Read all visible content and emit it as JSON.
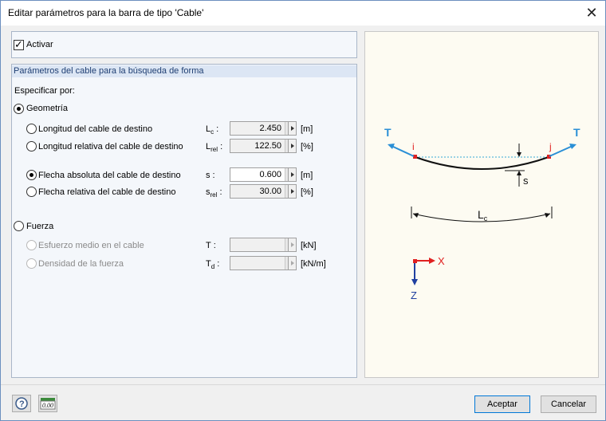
{
  "window": {
    "title": "Editar parámetros para la barra de tipo 'Cable'",
    "close_glyph": "✕"
  },
  "activar": {
    "label": "Activar",
    "checked": true
  },
  "section": {
    "title": "Parámetros del cable para la búsqueda de forma"
  },
  "specify": {
    "label": "Especificar por:"
  },
  "geometry": {
    "label": "Geometría",
    "selected": true,
    "rows": [
      {
        "label": "Longitud del cable de destino",
        "sym": "L",
        "sub": "c",
        "colon": " :",
        "value": "2.450",
        "unit": "[m]",
        "selected": false
      },
      {
        "label": "Longitud relativa del cable de destino",
        "sym": "L",
        "sub": "rel",
        "colon": " :",
        "value": "122.50",
        "unit": "[%]",
        "selected": false
      },
      {
        "label": "Flecha absoluta del cable de destino",
        "sym": "s",
        "sub": "",
        "colon": " :",
        "value": "0.600",
        "unit": "[m]",
        "selected": true
      },
      {
        "label": "Flecha relativa del cable de destino",
        "sym": "s",
        "sub": "rel",
        "colon": " :",
        "value": "30.00",
        "unit": "[%]",
        "selected": false
      }
    ]
  },
  "force": {
    "label": "Fuerza",
    "selected": false,
    "rows": [
      {
        "label": "Esfuerzo medio en el cable",
        "sym": "T",
        "sub": "",
        "colon": " :",
        "value": "",
        "unit": "[kN]"
      },
      {
        "label": "Densidad de la fuerza",
        "sym": "T",
        "sub": "d",
        "colon": " :",
        "value": "",
        "unit": "[kN/m]"
      }
    ]
  },
  "figure": {
    "labels": {
      "T_left": "T",
      "T_right": "T",
      "i": "i",
      "j": "j",
      "s": "s",
      "Lc": "L",
      "Lc_sub": "c",
      "x": "X",
      "z": "Z"
    },
    "colors": {
      "arrow": "#2a8fd6",
      "node": "#e02020",
      "axis_x": "#e02020",
      "axis_z": "#2040a0"
    }
  },
  "buttons": {
    "ok": "Aceptar",
    "cancel": "Cancelar",
    "help_icon": "help-icon",
    "units_icon": "units-icon",
    "units_text": "0.00"
  }
}
